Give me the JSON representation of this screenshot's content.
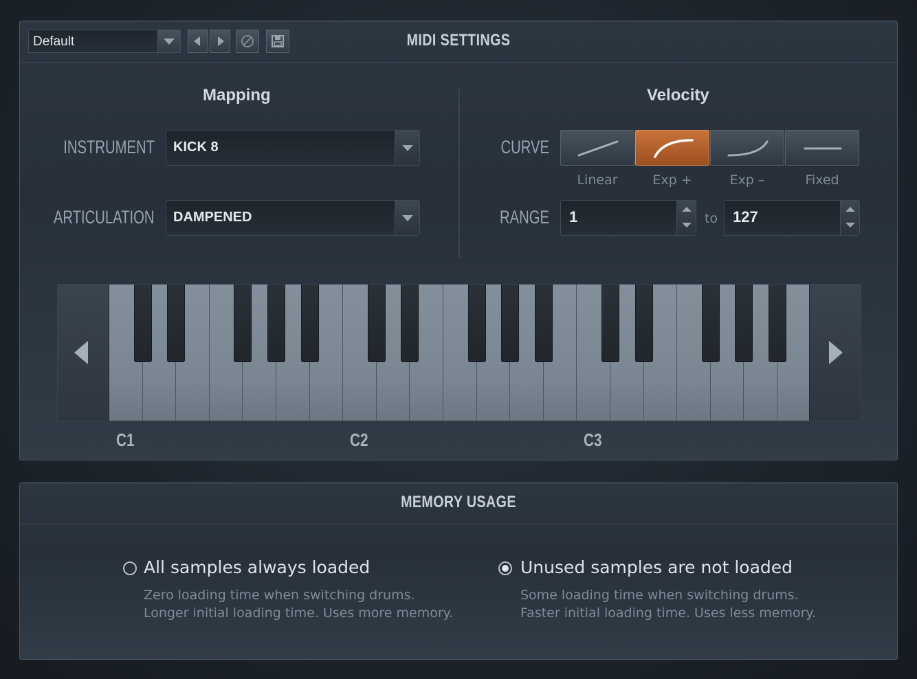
{
  "toolbar": {
    "preset_value": "Default",
    "panel_title": "MIDI SETTINGS"
  },
  "mapping": {
    "heading": "Mapping",
    "instrument_label": "INSTRUMENT",
    "instrument_value": "KICK 8",
    "articulation_label": "ARTICULATION",
    "articulation_value": "DAMPENED"
  },
  "velocity": {
    "heading": "Velocity",
    "curve_label": "CURVE",
    "curves": [
      "Linear",
      "Exp +",
      "Exp –",
      "Fixed"
    ],
    "active_curve": "Exp +",
    "range_label": "RANGE",
    "range_min": "1",
    "range_to": "to",
    "range_max": "127"
  },
  "keyboard": {
    "octave_labels": [
      "C1",
      "C2",
      "C3"
    ]
  },
  "memory": {
    "title": "MEMORY USAGE",
    "options": [
      {
        "title": "All samples always loaded",
        "line1": "Zero loading time when switching drums.",
        "line2": "Longer initial loading time. Uses more memory.",
        "selected": false
      },
      {
        "title": "Unused samples are not loaded",
        "line1": "Some loading time when switching drums.",
        "line2": "Faster initial loading time. Uses less memory.",
        "selected": true
      }
    ]
  },
  "colors": {
    "accent": "#c06a32",
    "background": "#1d242c"
  }
}
